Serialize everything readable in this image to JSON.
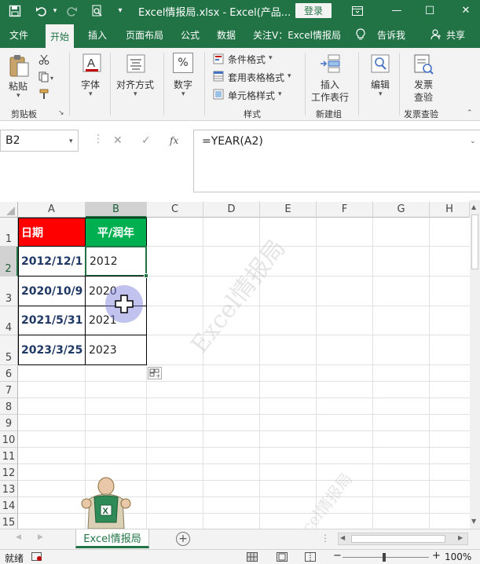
{
  "titlebar": {
    "title": "Excel情报局.xlsx  -  Excel(产品...",
    "login": "登录",
    "buttons": {
      "minimize": "—",
      "restore": "☐",
      "close": "✕"
    }
  },
  "tabs": [
    {
      "label": "文件"
    },
    {
      "label": "开始"
    },
    {
      "label": "插入"
    },
    {
      "label": "页面布局"
    },
    {
      "label": "公式"
    },
    {
      "label": "数据"
    },
    {
      "label": "关注V：Excel情报局"
    },
    {
      "label": "告诉我"
    },
    {
      "label": "共享"
    }
  ],
  "ribbon": {
    "paste": "粘贴",
    "clipboard": "剪贴板",
    "font": "字体",
    "align": "对齐方式",
    "number": "数字",
    "percent": "%",
    "cond_format": "条件格式",
    "table_format": "套用表格格式",
    "cell_style": "单元格样式",
    "styles": "样式",
    "insert_line1": "插入",
    "insert_line2": "工作表行",
    "insert_group": "新建组",
    "edit": "编辑",
    "invoice_line1": "发票",
    "invoice_line2": "查验",
    "invoice_group": "发票查验"
  },
  "formula_bar": {
    "name_box": "B2",
    "formula": "=YEAR(A2)"
  },
  "grid": {
    "columns": [
      "A",
      "B",
      "C",
      "D",
      "E",
      "F",
      "G",
      "H"
    ],
    "rows": [
      "1",
      "2",
      "3",
      "4",
      "5",
      "6",
      "7",
      "8",
      "9",
      "10",
      "11",
      "12",
      "13",
      "14",
      "15"
    ],
    "header": [
      "日期",
      "平/润年"
    ],
    "data": [
      [
        "2012/12/1",
        "2012"
      ],
      [
        "2020/10/9",
        "2020"
      ],
      [
        "2021/5/31",
        "2021"
      ],
      [
        "2023/3/25",
        "2023"
      ]
    ]
  },
  "watermark": "Excel情报局",
  "sheet_tab": "Excel情报局",
  "status": {
    "ready": "就绪",
    "zoom": "100%",
    "zoom_minus": "−",
    "zoom_plus": "+"
  }
}
